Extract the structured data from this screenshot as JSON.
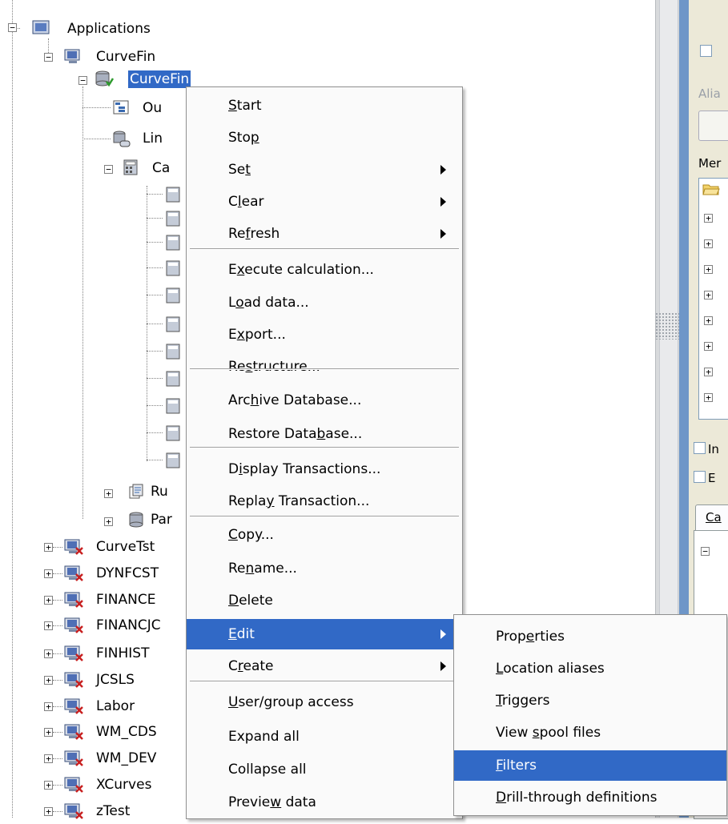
{
  "tree": {
    "root": {
      "label": "Applications"
    },
    "app": {
      "label": "CurveFin"
    },
    "database": {
      "label": "CurveFin"
    },
    "db_children": [
      {
        "label": "Ou"
      },
      {
        "label": "Lin"
      },
      {
        "label": "Ca"
      }
    ],
    "lower_children": [
      {
        "label": "Ru"
      },
      {
        "label": "Par"
      }
    ],
    "apps": [
      {
        "label": "CurveTst"
      },
      {
        "label": "DYNFCST"
      },
      {
        "label": "FINANCE"
      },
      {
        "label": "FINANCJC"
      },
      {
        "label": "FINHIST"
      },
      {
        "label": "JCSLS"
      },
      {
        "label": "Labor"
      },
      {
        "label": "WM_CDS"
      },
      {
        "label": "WM_DEV"
      },
      {
        "label": "XCurves"
      },
      {
        "label": "zTest"
      }
    ]
  },
  "context_menu": {
    "items": [
      {
        "pre": "",
        "key": "S",
        "post": "tart"
      },
      {
        "pre": "Sto",
        "key": "p",
        "post": ""
      },
      {
        "pre": "Se",
        "key": "t",
        "post": ""
      },
      {
        "pre": "C",
        "key": "l",
        "post": "ear"
      },
      {
        "pre": "Re",
        "key": "f",
        "post": "resh"
      },
      {
        "pre": "E",
        "key": "x",
        "post": "ecute calculation..."
      },
      {
        "pre": "L",
        "key": "o",
        "post": "ad data..."
      },
      {
        "pre": "E",
        "key": "x",
        "post": "port..."
      },
      {
        "pre": "Re",
        "key": "s",
        "post": "tructure..."
      },
      {
        "pre": "Arc",
        "key": "h",
        "post": "ive Database..."
      },
      {
        "pre": "Restore Data",
        "key": "b",
        "post": "ase..."
      },
      {
        "pre": "D",
        "key": "i",
        "post": "splay Transactions..."
      },
      {
        "pre": "Repla",
        "key": "y",
        "post": " Transaction..."
      },
      {
        "pre": "",
        "key": "C",
        "post": "opy..."
      },
      {
        "pre": "Re",
        "key": "n",
        "post": "ame..."
      },
      {
        "pre": "",
        "key": "D",
        "post": "elete"
      },
      {
        "pre": "",
        "key": "E",
        "post": "dit"
      },
      {
        "pre": "C",
        "key": "r",
        "post": "eate"
      },
      {
        "pre": "",
        "key": "U",
        "post": "ser/group access"
      },
      {
        "pre": "",
        "key": "",
        "post": "Expand all"
      },
      {
        "pre": "",
        "key": "",
        "post": "Collapse all"
      },
      {
        "pre": "Previe",
        "key": "w",
        "post": " data"
      }
    ]
  },
  "submenu": {
    "items": [
      {
        "pre": "Prop",
        "key": "e",
        "post": "rties"
      },
      {
        "pre": "",
        "key": "L",
        "post": "ocation aliases"
      },
      {
        "pre": "",
        "key": "T",
        "post": "riggers"
      },
      {
        "pre": "View ",
        "key": "s",
        "post": "pool files"
      },
      {
        "pre": "",
        "key": "F",
        "post": "ilters"
      },
      {
        "pre": "",
        "key": "D",
        "post": "rill-through definitions"
      }
    ]
  },
  "right_panel": {
    "alias_label": "Alia",
    "members_label": "Mer",
    "check1": "In",
    "check2": "E",
    "tab_label": "Ca"
  },
  "colors": {
    "selection": "#3169c6",
    "splitter": "#6e96c8",
    "panel_bg": "#ece9d8"
  }
}
